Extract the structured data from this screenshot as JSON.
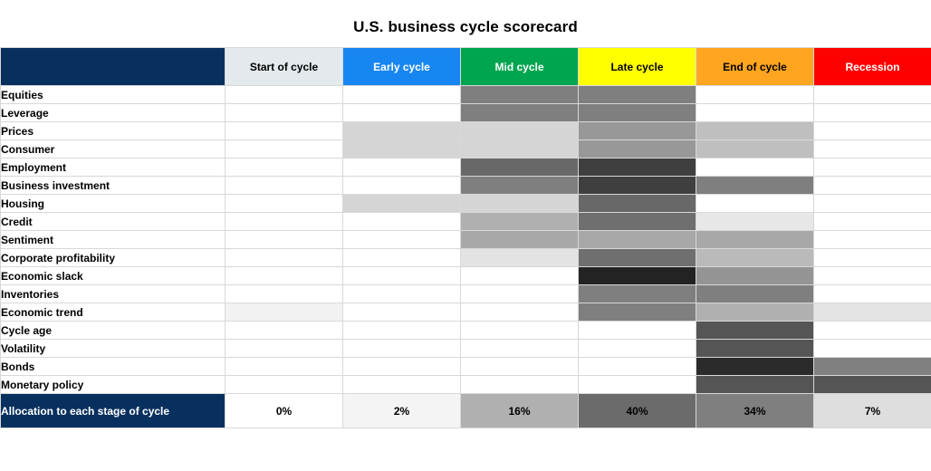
{
  "title": "U.S. business cycle scorecard",
  "colors": {
    "navy": "#08305e",
    "start_of_cycle": "#e3e9ed",
    "early_cycle": "#1886f0",
    "mid_cycle": "#00a550",
    "late_cycle": "#ffff00",
    "end_of_cycle": "#ffa51f",
    "recession": "#fd0000"
  },
  "header": {
    "corner_label": "",
    "stages": [
      "Start of cycle",
      "Early cycle",
      "Mid cycle",
      "Late cycle",
      "End of cycle",
      "Recession"
    ]
  },
  "chart_data": {
    "type": "heatmap",
    "title": "U.S. business cycle scorecard",
    "xlabel": "",
    "ylabel": "",
    "categories": [
      "Start of cycle",
      "Early cycle",
      "Mid cycle",
      "Late cycle",
      "End of cycle",
      "Recession"
    ],
    "rows": [
      "Equities",
      "Leverage",
      "Prices",
      "Consumer",
      "Employment",
      "Business investment",
      "Housing",
      "Credit",
      "Sentiment",
      "Corporate profitability",
      "Economic slack",
      "Inventories",
      "Economic trend",
      "Cycle age",
      "Volatility",
      "Bonds",
      "Monetary policy"
    ],
    "colorscale": "grayscale-darker-is-stronger",
    "values": [
      {
        "row": "Equities",
        "cells": [
          "#ffffff",
          "#ffffff",
          "#7f7f7f",
          "#7f7f7f",
          "#ffffff",
          "#ffffff"
        ]
      },
      {
        "row": "Leverage",
        "cells": [
          "#ffffff",
          "#ffffff",
          "#7f7f7f",
          "#7f7f7f",
          "#ffffff",
          "#ffffff"
        ]
      },
      {
        "row": "Prices",
        "cells": [
          "#ffffff",
          "#d5d5d5",
          "#d5d5d5",
          "#989898",
          "#bfbfbf",
          "#ffffff"
        ]
      },
      {
        "row": "Consumer",
        "cells": [
          "#ffffff",
          "#d5d5d5",
          "#d5d5d5",
          "#989898",
          "#bfbfbf",
          "#ffffff"
        ]
      },
      {
        "row": "Employment",
        "cells": [
          "#ffffff",
          "#ffffff",
          "#686868",
          "#3f3f3f",
          "#ffffff",
          "#ffffff"
        ]
      },
      {
        "row": "Business investment",
        "cells": [
          "#ffffff",
          "#ffffff",
          "#7f7f7f",
          "#3f3f3f",
          "#7f7f7f",
          "#ffffff"
        ]
      },
      {
        "row": "Housing",
        "cells": [
          "#ffffff",
          "#d5d5d5",
          "#d5d5d5",
          "#686868",
          "#ffffff",
          "#ffffff"
        ]
      },
      {
        "row": "Credit",
        "cells": [
          "#ffffff",
          "#ffffff",
          "#b0b0b0",
          "#6f6f6f",
          "#e7e7e7",
          "#ffffff"
        ]
      },
      {
        "row": "Sentiment",
        "cells": [
          "#ffffff",
          "#ffffff",
          "#a8a8a8",
          "#a8a8a8",
          "#a8a8a8",
          "#ffffff"
        ]
      },
      {
        "row": "Corporate profitability",
        "cells": [
          "#ffffff",
          "#ffffff",
          "#e3e3e3",
          "#6f6f6f",
          "#bababa",
          "#ffffff"
        ]
      },
      {
        "row": "Economic slack",
        "cells": [
          "#ffffff",
          "#ffffff",
          "#ffffff",
          "#232323",
          "#949494",
          "#ffffff"
        ]
      },
      {
        "row": "Inventories",
        "cells": [
          "#ffffff",
          "#ffffff",
          "#ffffff",
          "#7f7f7f",
          "#7f7f7f",
          "#ffffff"
        ]
      },
      {
        "row": "Economic trend",
        "cells": [
          "#f2f2f2",
          "#ffffff",
          "#ffffff",
          "#7f7f7f",
          "#b0b0b0",
          "#e4e4e4"
        ]
      },
      {
        "row": "Cycle age",
        "cells": [
          "#ffffff",
          "#ffffff",
          "#ffffff",
          "#ffffff",
          "#555555",
          "#ffffff"
        ]
      },
      {
        "row": "Volatility",
        "cells": [
          "#ffffff",
          "#ffffff",
          "#ffffff",
          "#ffffff",
          "#555555",
          "#ffffff"
        ]
      },
      {
        "row": "Bonds",
        "cells": [
          "#ffffff",
          "#ffffff",
          "#ffffff",
          "#ffffff",
          "#2b2b2b",
          "#808080"
        ]
      },
      {
        "row": "Monetary policy",
        "cells": [
          "#ffffff",
          "#ffffff",
          "#ffffff",
          "#ffffff",
          "#555555",
          "#555555"
        ]
      }
    ]
  },
  "footer": {
    "label": "Allocation to each stage of cycle",
    "allocations": [
      {
        "stage": "Start of cycle",
        "value": "0%",
        "fill": "#ffffff"
      },
      {
        "stage": "Early cycle",
        "value": "2%",
        "fill": "#f4f4f4"
      },
      {
        "stage": "Mid cycle",
        "value": "16%",
        "fill": "#b0b0b0"
      },
      {
        "stage": "Late cycle",
        "value": "40%",
        "fill": "#6b6b6b"
      },
      {
        "stage": "End of cycle",
        "value": "34%",
        "fill": "#7f7f7f"
      },
      {
        "stage": "Recession",
        "value": "7%",
        "fill": "#dedede"
      }
    ]
  }
}
